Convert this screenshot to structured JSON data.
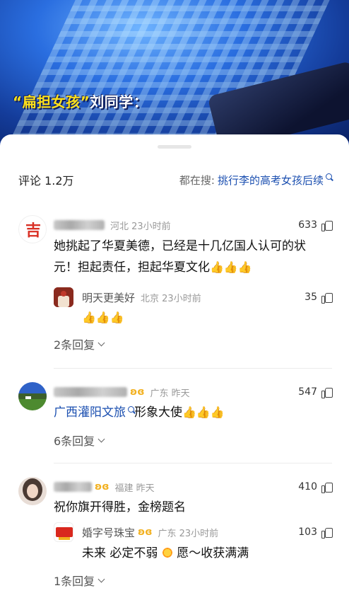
{
  "video": {
    "caption_quote": "“扁担女孩”",
    "caption_name": "刘同学："
  },
  "header": {
    "comment_count": "评论 1.2万",
    "search_prefix": "都在搜:",
    "search_keyword": "挑行李的高考女孩后续"
  },
  "comments": [
    {
      "location_time": "河北 23小时前",
      "likes": "633",
      "text_1": "她挑起了华夏美德，已经是十几亿国人认可的状",
      "text_2": "元！担起责任，担起华夏文化",
      "emoji": "👍👍👍",
      "reply": {
        "name": "明天更美好",
        "location_time": "北京 23小时前",
        "likes": "35",
        "emoji": "👍👍👍"
      },
      "replies_label": "2条回复"
    },
    {
      "location_time": "广东 昨天",
      "likes": "547",
      "link_text": "广西灌阳文旅",
      "text_after": "形象大使",
      "emoji": "👍👍👍",
      "replies_label": "6条回复"
    },
    {
      "location_time": "福建 昨天",
      "likes": "410",
      "text": "祝你旗开得胜，金榜题名",
      "reply": {
        "name": "婚字号珠宝",
        "location_time": "广东 23小时前",
        "likes": "103",
        "text_before": "未来 必定不弱",
        "text_after": "愿～收获满满"
      },
      "replies_label": "1条回复"
    }
  ],
  "colors": {
    "link": "#1b4fb0",
    "caption": "#ffe11a",
    "badge": "#f2b01e"
  }
}
